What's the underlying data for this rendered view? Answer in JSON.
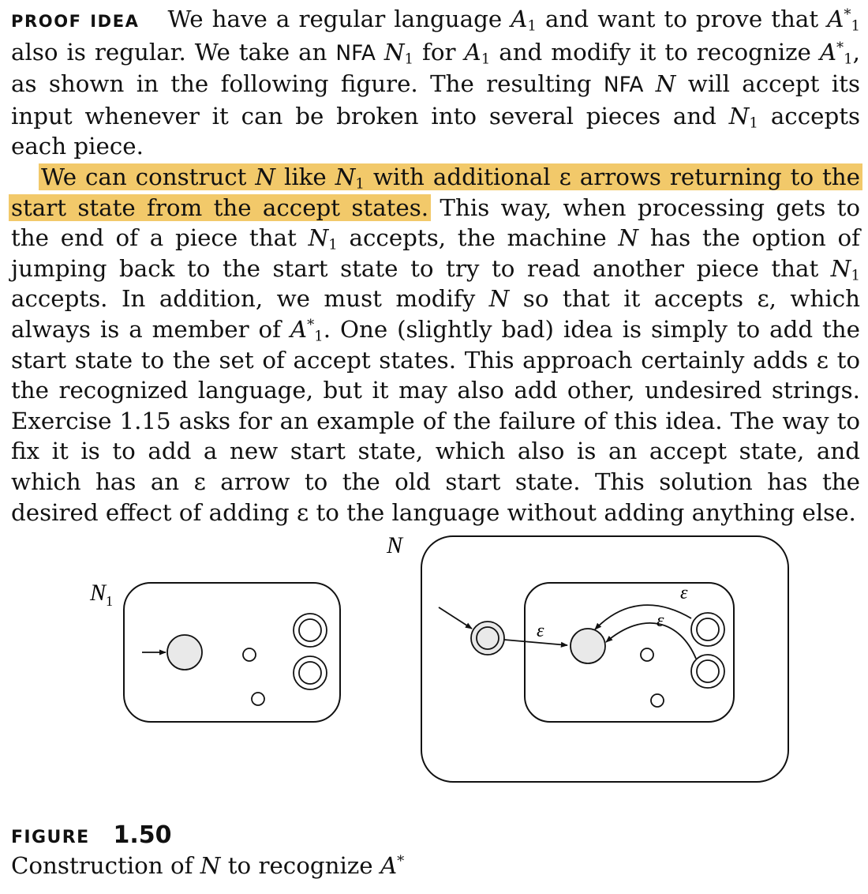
{
  "proof": {
    "label": "PROOF IDEA",
    "p1": {
      "t1": "We have a regular language ",
      "A": "A",
      "sub1": "1",
      "t2": " and want to prove that ",
      "A2": "A",
      "sup2": "*",
      "sub2": "1",
      "t3": " also is regular. We take an ",
      "nfa": "NFA",
      "t4": " ",
      "N1": "N",
      "sub3": "1",
      "t5": " for ",
      "A3": "A",
      "sub4": "1",
      "t6": " and modify it to recognize ",
      "A4": "A",
      "sup5": "*",
      "sub5": "1",
      "t7": ", as shown in the following figure. The resulting ",
      "nfa2": "NFA",
      "t8": " ",
      "N2": "N",
      "t9": " will accept its input whenever it can be broken into several pieces and ",
      "N3": "N",
      "sub6": "1",
      "t10": " accepts each piece."
    },
    "p2": {
      "h1": "We can construct ",
      "N": "N",
      "h2": " like ",
      "N1": "N",
      "sub1": "1",
      "h3": " with additional ",
      "eps1": "ε",
      "h4": " arrows returning to the start state from the accept states.",
      "t1": " This way, when processing gets to the end of a piece that ",
      "N2": "N",
      "sub2": "1",
      "t2": " accepts, the machine ",
      "N3": "N",
      "t3": " has the option of jumping back to the start state to try to read another piece that ",
      "N4": "N",
      "sub3": "1",
      "t4": " accepts. In addition, we must modify ",
      "N5": "N",
      "t5": " so that it accepts ",
      "eps2": "ε",
      "t6": ", which always is a member of ",
      "A": "A",
      "sup4": "*",
      "sub4": "1",
      "t7": ". One (slightly bad) idea is simply to add the start state to the set of accept states. This approach certainly adds ",
      "eps3": "ε",
      "t8": " to the recognized language, but it may also add other, undesired strings. Exercise 1.15 asks for an example of the failure of this idea. The way to fix it is to add a new start state, which also is an accept state, and which has an ",
      "eps4": "ε",
      "t9": " arrow to the old start state. This solution has the desired effect of adding ",
      "eps5": "ε",
      "t10": " to the language without adding anything else."
    }
  },
  "figure": {
    "n1_label": {
      "main": "N",
      "sub": "1"
    },
    "n_label": "N",
    "eps_labels": [
      "ε",
      "ε",
      "ε"
    ],
    "caption": {
      "label": "FIGURE",
      "number": "1.50",
      "text": "Construction of ",
      "N": "N",
      "text2": " to recognize ",
      "A": "A",
      "sup": "*"
    }
  }
}
